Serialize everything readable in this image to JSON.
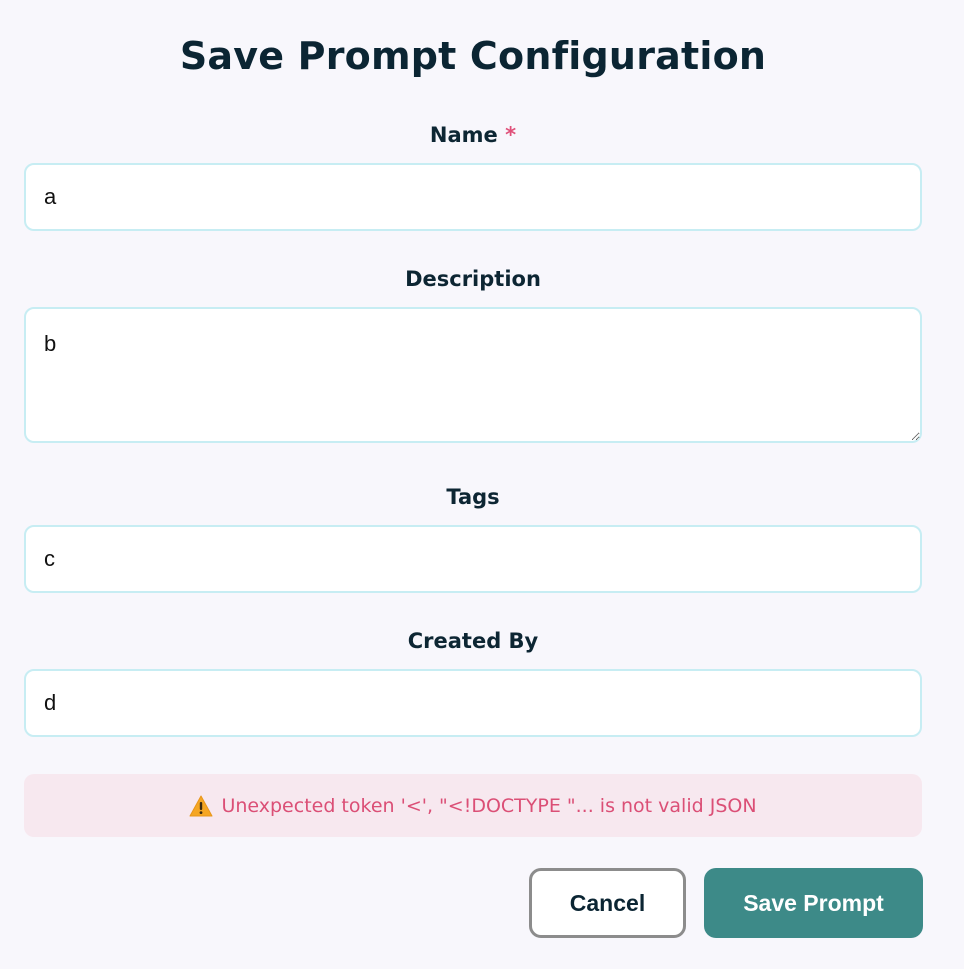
{
  "dialog": {
    "title": "Save Prompt Configuration",
    "fields": {
      "name": {
        "label": "Name",
        "required_marker": "*",
        "value": "a"
      },
      "description": {
        "label": "Description",
        "value": "b"
      },
      "tags": {
        "label": "Tags",
        "value": "c"
      },
      "created_by": {
        "label": "Created By",
        "value": "d"
      }
    },
    "error": {
      "icon": "warning-icon",
      "message": "Unexpected token '<', \"<!DOCTYPE \"... is not valid JSON"
    },
    "buttons": {
      "cancel": "Cancel",
      "save": "Save Prompt"
    }
  },
  "colors": {
    "background": "#f8f7fc",
    "title_text": "#0b2533",
    "input_border": "#c7edf3",
    "required_star": "#e0517a",
    "error_background": "#f7e8ef",
    "error_text": "#db4f76",
    "primary_button": "#3d8a88",
    "cancel_border": "#8c8c8c"
  }
}
